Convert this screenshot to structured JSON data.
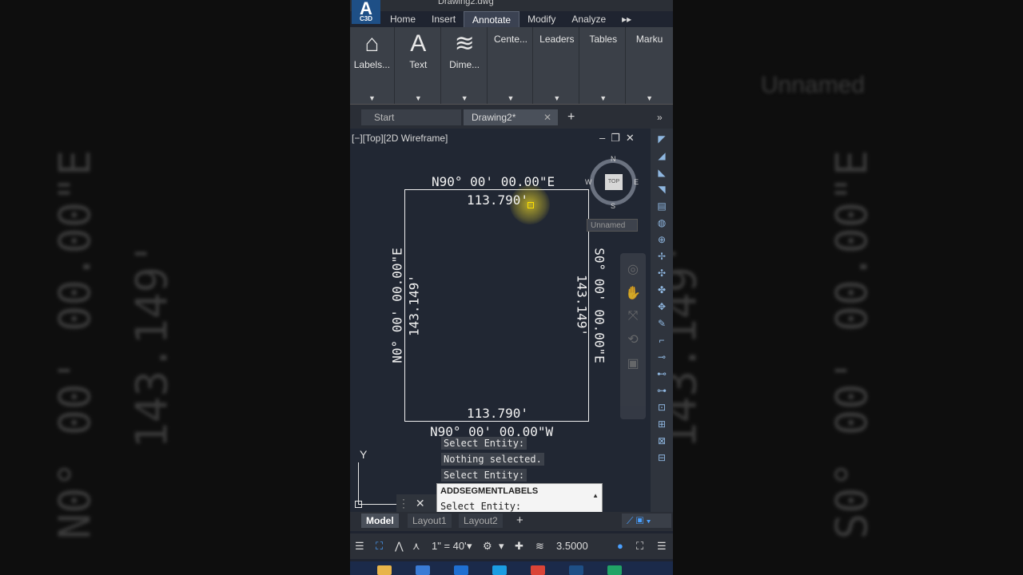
{
  "window": {
    "title": "Drawing2.dwg"
  },
  "app": {
    "logo_letter": "A",
    "logo_sub": "C3D"
  },
  "ribbon_tabs": [
    "Home",
    "Insert",
    "Annotate",
    "Modify",
    "Analyze",
    "▸▸"
  ],
  "ribbon_panels": {
    "labels": {
      "label": "Labels...",
      "icon": "tag-icon"
    },
    "text": {
      "label": "Text",
      "icon": "text-icon"
    },
    "dimensions": {
      "label": "Dime...",
      "icon": "dimension-icon"
    },
    "centerlines": {
      "label": "Cente..."
    },
    "leaders": {
      "label": "Leaders"
    },
    "tables": {
      "label": "Tables"
    },
    "markup": {
      "label": "Marku"
    }
  },
  "file_tabs": {
    "start": "Start",
    "drawing": "Drawing2*"
  },
  "viewport": {
    "label": "[−][Top][2D Wireframe]",
    "top_bearing": "N90° 00' 00.00\"E",
    "top_distance": "113.790'",
    "bottom_distance": "113.790'",
    "bottom_bearing": "N90° 00' 00.00\"W",
    "left_bearing": "N0° 00' 00.00\"E",
    "left_distance": "143.149'",
    "right_distance": "143.149'",
    "right_bearing": "S0° 00' 00.00\"E",
    "compass": {
      "n": "N",
      "s": "S",
      "e": "E",
      "w": "W",
      "cube": "TOP"
    },
    "named_view": "Unnamed",
    "ucs_y": "Y"
  },
  "command": {
    "history": [
      "Select Entity:",
      "Nothing selected.",
      "Select Entity:"
    ],
    "current_command": "ADDSEGMENTLABELS",
    "prompt": "Select Entity:"
  },
  "layout_tabs": {
    "model": "Model",
    "layout1": "Layout1",
    "layout2": "Layout2"
  },
  "status": {
    "scale": "1\" = 40'",
    "annotation_value": "3.5000"
  },
  "colors": {
    "accent": "#4aa0ff",
    "highlight": "#e6d228",
    "background": "#212733"
  }
}
